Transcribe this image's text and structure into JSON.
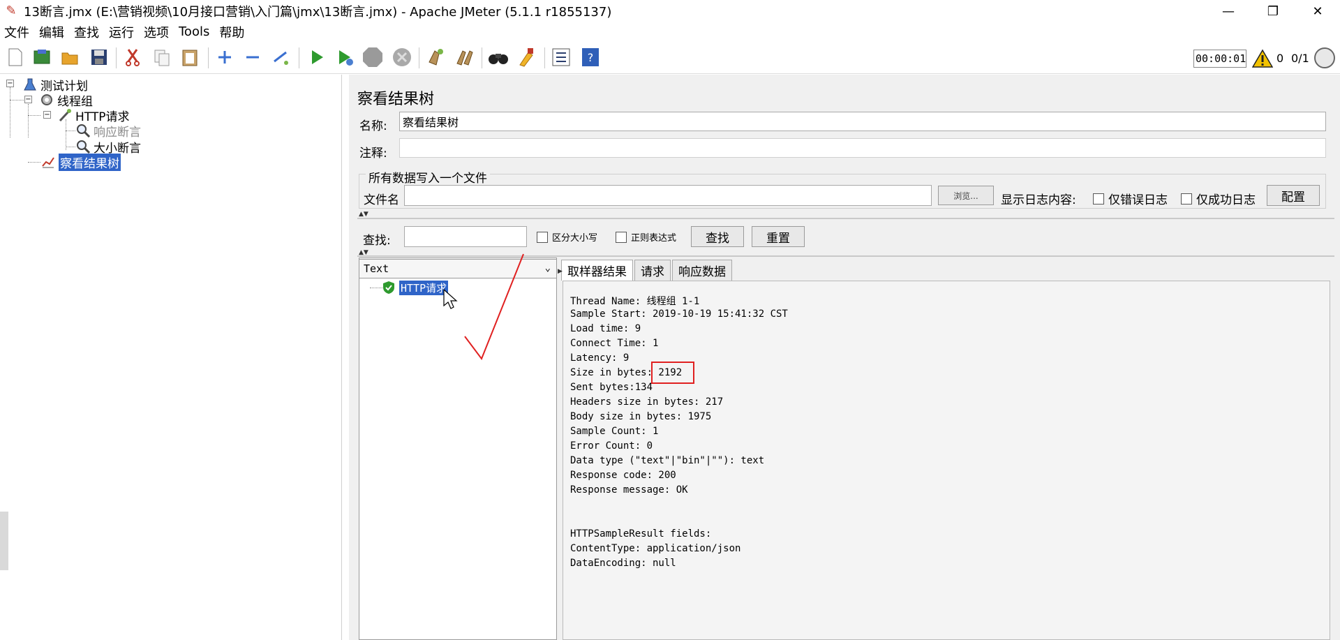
{
  "window": {
    "title": "13断言.jmx (E:\\营销视频\\10月接口营销\\入门篇\\jmx\\13断言.jmx) - Apache JMeter (5.1.1 r1855137)",
    "minimize_glyph": "—",
    "maximize_glyph": "❐",
    "close_glyph": "✕"
  },
  "menu": [
    "文件",
    "编辑",
    "查找",
    "运行",
    "选项",
    "Tools",
    "帮助"
  ],
  "toolbar": {
    "timer": "00:00:01",
    "error_count": "0",
    "threads": "0/1",
    "icons": [
      "new-icon",
      "templates-icon",
      "open-icon",
      "save-icon",
      "cut-icon",
      "copy-icon",
      "paste-icon",
      "expand-icon",
      "collapse-icon",
      "toggle-icon",
      "start-icon",
      "start-no-pause-icon",
      "stop-icon",
      "shutdown-icon",
      "clear-icon",
      "clear-all-icon",
      "search-icon",
      "reset-search-icon",
      "function-helper-icon",
      "help-icon"
    ]
  },
  "tree": {
    "test_plan": "测试计划",
    "thread_group": "线程组",
    "http_request": "HTTP请求",
    "response_assertion": "响应断言",
    "size_assertion": "大小断言",
    "view_results_tree": "察看结果树"
  },
  "panel": {
    "title": "察看结果树",
    "name_label": "名称:",
    "name_value": "察看结果树",
    "comment_label": "注释:",
    "comment_value": "",
    "group_title": "所有数据写入一个文件",
    "filename_label": "文件名",
    "filename_value": "",
    "browse_button": "浏览...",
    "log_display_label": "显示日志内容:",
    "errors_only": "仅错误日志",
    "successes_only": "仅成功日志",
    "configure_button": "配置",
    "search_label": "查找:",
    "search_value": "",
    "case_sensitive": "区分大小写",
    "regex": "正则表达式",
    "find_button": "查找",
    "reset_button": "重置"
  },
  "results": {
    "renderer": "Text",
    "sample": "HTTP请求",
    "tabs": [
      "取样器结果",
      "请求",
      "响应数据"
    ],
    "lines": [
      "Thread Name: 线程组 1-1",
      "Sample Start: 2019-10-19 15:41:32 CST",
      "Load time: 9",
      "Connect Time: 1",
      "Latency: 9",
      "Size in bytes: 2192",
      "Sent bytes:134",
      "Headers size in bytes: 217",
      "Body size in bytes: 1975",
      "Sample Count: 1",
      "Error Count: 0",
      "Data type (\"text\"|\"bin\"|\"\"): text",
      "Response code: 200",
      "Response message: OK",
      "",
      "",
      "HTTPSampleResult fields:",
      "ContentType: application/json",
      "DataEncoding: null"
    ]
  },
  "colors": {
    "selection": "#2f64c8",
    "annotation": "#e02020",
    "panel_bg": "#f0f0f0"
  }
}
